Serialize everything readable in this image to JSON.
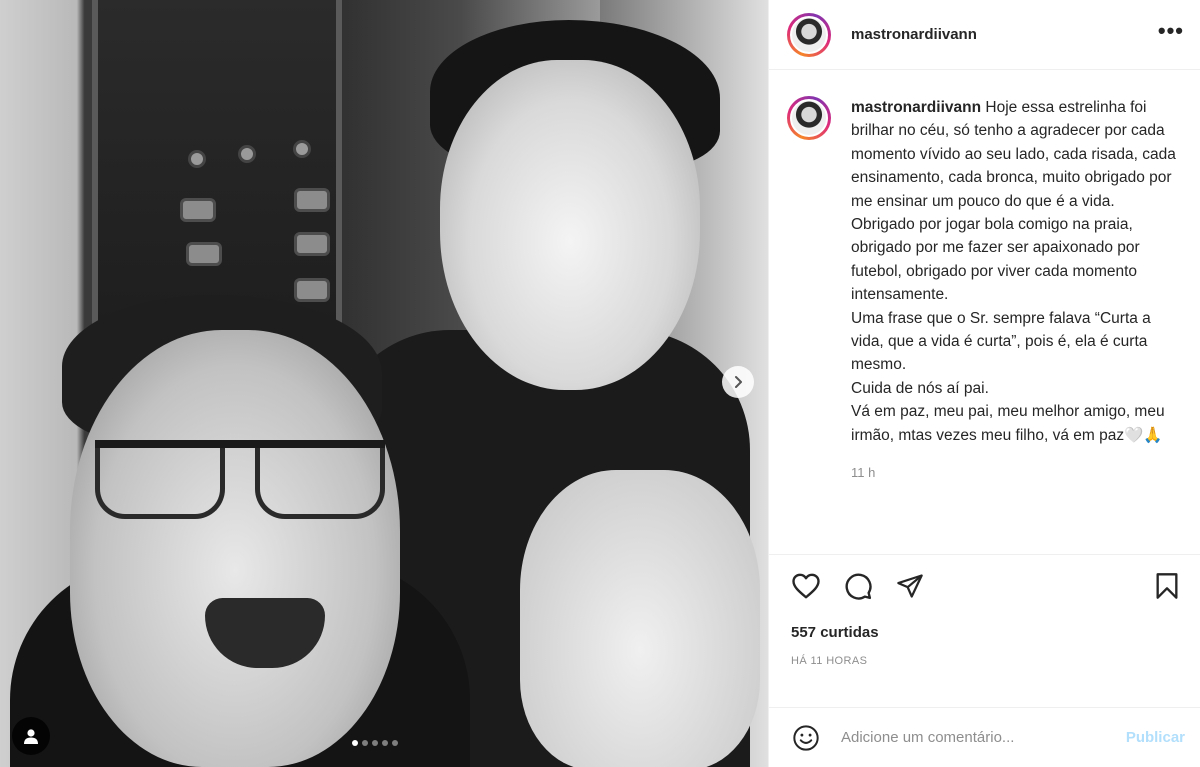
{
  "post": {
    "username": "mastronardiivann",
    "caption": "Hoje essa estrelinha foi brilhar no céu, só tenho a agradecer por cada momento vívido ao seu lado, cada risada, cada ensinamento, cada bronca, muito obrigado por me ensinar um pouco do que é a vida. Obrigado por jogar bola comigo na praia, obrigado por me fazer ser apaixonado por futebol, obrigado por viver cada momento intensamente.\nUma frase que o Sr. sempre falava “Curta a vida, que a vida é curta”, pois é, ela é curta mesmo.\nCuida de nós aí pai.\nVá em paz, meu pai, meu melhor amigo, meu irmão, mtas vezes meu filho, vá em paz🤍🙏",
    "caption_time": "11 h",
    "likes": "557 curtidas",
    "posted_ago": "HÁ 11 HORAS",
    "more_options": "•••"
  },
  "carousel": {
    "total": 5,
    "active_index": 0
  },
  "comment_form": {
    "placeholder": "Adicione um comentário...",
    "publish_label": "Publicar"
  },
  "icons": {
    "like": "heart-icon",
    "comment": "comment-icon",
    "share": "paper-plane-icon",
    "save": "bookmark-icon",
    "emoji": "smiley-icon",
    "next": "chevron-right-icon",
    "tags": "user-tag-icon"
  },
  "colors": {
    "publish_disabled": "#b2dffc",
    "secondary_text": "#8e8e8e",
    "primary_text": "#262626",
    "divider": "#efefef"
  }
}
